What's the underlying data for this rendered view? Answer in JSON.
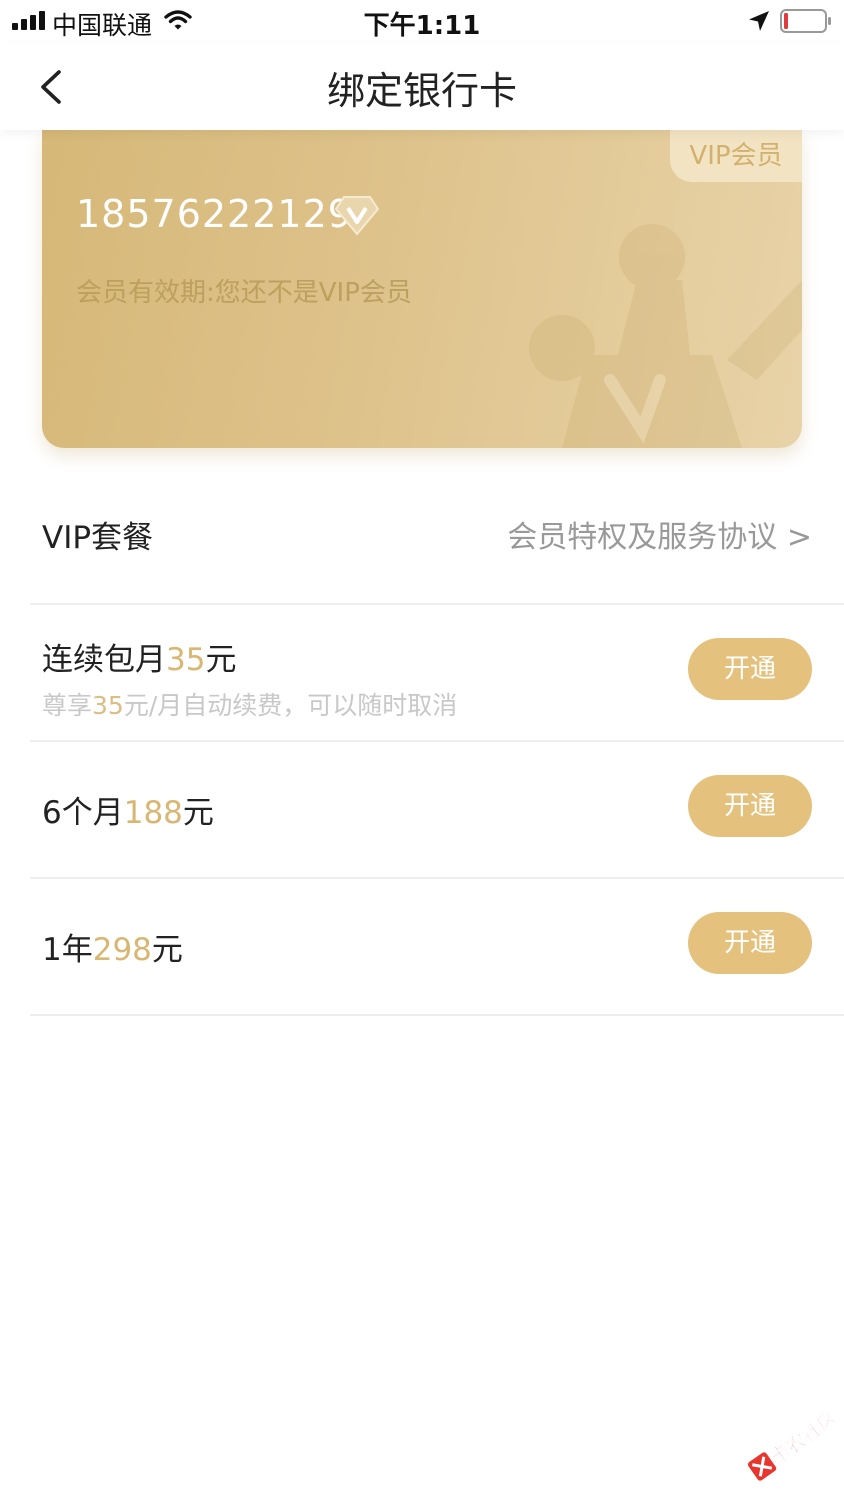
{
  "status_bar": {
    "carrier": "中国联通",
    "time": "下午1:11"
  },
  "nav": {
    "title": "绑定银行卡"
  },
  "vip_card": {
    "tag": "VIP会员",
    "phone": "18576222129",
    "validity": "会员有效期:您还不是VIP会员"
  },
  "packages": {
    "title": "VIP套餐",
    "link": "会员特权及服务协议 >",
    "plans": [
      {
        "name_prefix": "连续包月",
        "price": "35",
        "name_suffix": "元",
        "sub_prefix": "尊享",
        "sub_price": "35",
        "sub_suffix": "元/月自动续费，可以随时取消",
        "button": "开通"
      },
      {
        "name_prefix": "6个月",
        "price": "188",
        "name_suffix": "元",
        "button": "开通"
      },
      {
        "name_prefix": "1年",
        "price": "298",
        "name_suffix": "元",
        "button": "开通"
      }
    ]
  },
  "watermark": {
    "text": "卡农社区"
  },
  "colors": {
    "gold_accent": "#e4c27d",
    "price_text": "#d9b772",
    "card_start": "#d6b878",
    "card_end": "#e8d3a8"
  },
  "icons": [
    "signal-icon",
    "wifi-icon",
    "location-arrow-icon",
    "battery-icon",
    "back-arrow-icon",
    "diamond-v-icon"
  ]
}
